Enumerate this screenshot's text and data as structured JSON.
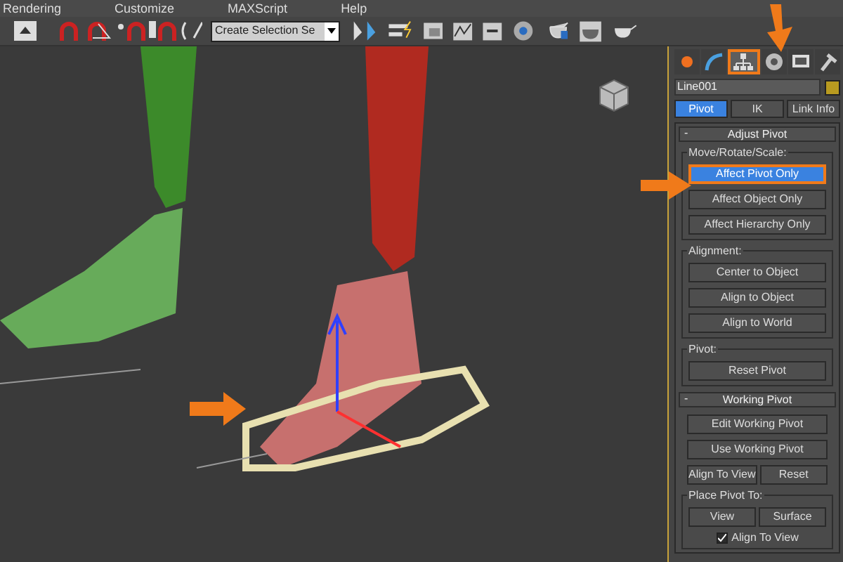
{
  "menu": [
    "Rendering",
    "Customize",
    "MAXScript",
    "Help"
  ],
  "toolbar": {
    "selection_set": "Create Selection Se"
  },
  "command_tabs": [
    {
      "selected": false,
      "highlighted": false
    },
    {
      "selected": false,
      "highlighted": false
    },
    {
      "selected": true,
      "highlighted": true
    },
    {
      "selected": false,
      "highlighted": false
    },
    {
      "selected": false,
      "highlighted": false
    },
    {
      "selected": false,
      "highlighted": false
    }
  ],
  "object_name": "Line001",
  "subtabs": [
    {
      "label": "Pivot",
      "selected": true
    },
    {
      "label": "IK",
      "selected": false
    },
    {
      "label": "Link Info",
      "selected": false
    }
  ],
  "rollouts": [
    {
      "toggle": "-",
      "title": "Adjust Pivot",
      "groups": [
        {
          "title": "Move/Rotate/Scale:",
          "rows": [
            [
              {
                "kind": "button",
                "label": "Affect Pivot Only",
                "selected": true,
                "highlighted": true
              }
            ],
            [
              {
                "kind": "button",
                "label": "Affect Object Only",
                "selected": false,
                "highlighted": false
              }
            ],
            [
              {
                "kind": "button",
                "label": "Affect Hierarchy Only",
                "selected": false,
                "highlighted": false
              }
            ]
          ]
        },
        {
          "title": "Alignment:",
          "rows": [
            [
              {
                "kind": "button",
                "label": "Center to Object",
                "selected": false,
                "highlighted": false
              }
            ],
            [
              {
                "kind": "button",
                "label": "Align to Object",
                "selected": false,
                "highlighted": false
              }
            ],
            [
              {
                "kind": "button",
                "label": "Align to World",
                "selected": false,
                "highlighted": false
              }
            ]
          ]
        },
        {
          "title": "Pivot:",
          "rows": [
            [
              {
                "kind": "button",
                "label": "Reset Pivot",
                "selected": false,
                "highlighted": false
              }
            ]
          ]
        }
      ]
    },
    {
      "toggle": "-",
      "title": "Working Pivot",
      "groups": [
        {
          "rows": [
            [
              {
                "kind": "button",
                "label": "Edit Working Pivot",
                "selected": false,
                "highlighted": false
              }
            ],
            [
              {
                "kind": "button",
                "label": "Use Working Pivot",
                "selected": false,
                "highlighted": false
              }
            ],
            [
              {
                "kind": "button",
                "label": "Align To View",
                "selected": false,
                "highlighted": false
              },
              {
                "kind": "button",
                "label": "Reset",
                "selected": false,
                "highlighted": false
              }
            ]
          ]
        },
        {
          "title": "Place Pivot To:",
          "rows": [
            [
              {
                "kind": "button",
                "label": "View",
                "selected": false,
                "highlighted": false
              },
              {
                "kind": "button",
                "label": "Surface",
                "selected": false,
                "highlighted": false
              }
            ],
            [
              {
                "kind": "checkbox",
                "label": "Align To View",
                "checked": true
              }
            ]
          ]
        }
      ]
    }
  ]
}
